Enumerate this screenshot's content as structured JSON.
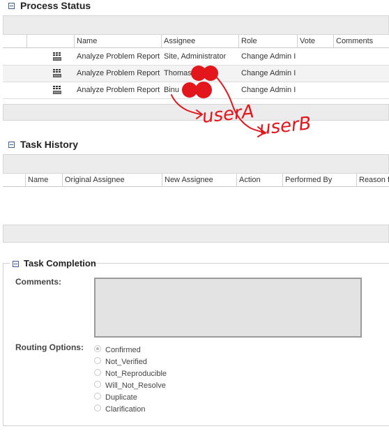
{
  "process_status": {
    "title": "Process Status",
    "columns": [
      "",
      "",
      "Name",
      "Assignee",
      "Role",
      "Vote",
      "Comments"
    ],
    "rows": [
      {
        "name": "Analyze Problem Report",
        "assignee": "Site, Administrator",
        "role": "Change Admin I"
      },
      {
        "name": "Analyze Problem Report",
        "assignee": "Thomas",
        "role": "Change Admin I"
      },
      {
        "name": "Analyze Problem Report",
        "assignee": "Binu",
        "role": "Change Admin I"
      }
    ]
  },
  "annotations": {
    "user_a": "userA",
    "user_b": "userB",
    "color": "#e3161b"
  },
  "task_history": {
    "title": "Task History",
    "columns": [
      "Name",
      "Original Assignee",
      "New Assignee",
      "Action",
      "Performed By",
      "Reason f"
    ]
  },
  "task_completion": {
    "title": "Task Completion",
    "comments_label": "Comments:",
    "comments_value": "",
    "routing_label": "Routing Options:",
    "routing_options": [
      "Confirmed",
      "Not_Verified",
      "Not_Reproducible",
      "Will_Not_Resolve",
      "Duplicate",
      "Clarification"
    ],
    "selected_option": "Confirmed"
  }
}
